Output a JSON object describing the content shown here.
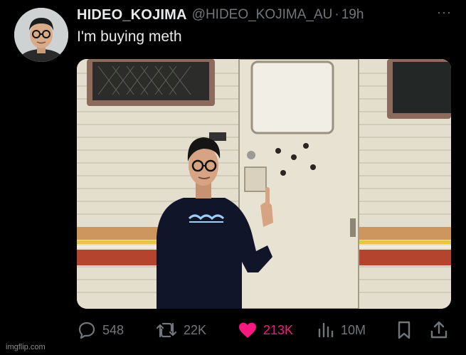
{
  "tweet": {
    "display_name": "HIDEO_KOJIMA",
    "handle": "@HIDEO_KOJIMA_AU",
    "separator": "·",
    "time": "19h",
    "more_label": "···",
    "text": "I'm buying meth"
  },
  "actions": {
    "replies": "548",
    "reposts": "22K",
    "likes": "213K",
    "views": "10M"
  },
  "colors": {
    "like_accent": "#f91880",
    "secondary_text": "#71767b",
    "primary_text": "#e7e9ea"
  },
  "icons": [
    "reply-icon",
    "repost-icon",
    "heart-icon",
    "views-icon",
    "bookmark-icon",
    "share-icon"
  ],
  "watermark": "imgflip.com"
}
